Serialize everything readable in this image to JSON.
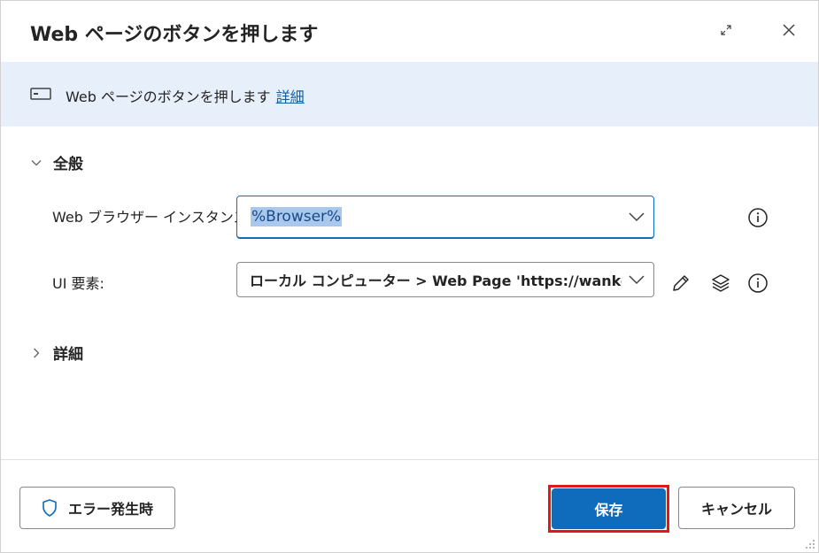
{
  "dialog": {
    "title": "Web ページのボタンを押します",
    "expand_icon": "expand-icon",
    "close_icon": "close-icon"
  },
  "banner": {
    "icon": "action-icon",
    "text": "Web ページのボタンを押します",
    "link": "詳細"
  },
  "sections": {
    "general": "全般",
    "advanced": "詳細"
  },
  "fields": {
    "browser_label": "Web ブラウザー インスタンス:",
    "browser_value": "%Browser%",
    "ui_label": "UI 要素:",
    "ui_value": "ローカル コンピューター > Web Page 'https://wankochallenge"
  },
  "footer": {
    "on_error": "エラー発生時",
    "save": "保存",
    "cancel": "キャンセル"
  },
  "colors": {
    "accent": "#0f6cbd",
    "banner_bg": "#e7effa",
    "highlight": "#e3161b",
    "link": "#115ea3"
  }
}
